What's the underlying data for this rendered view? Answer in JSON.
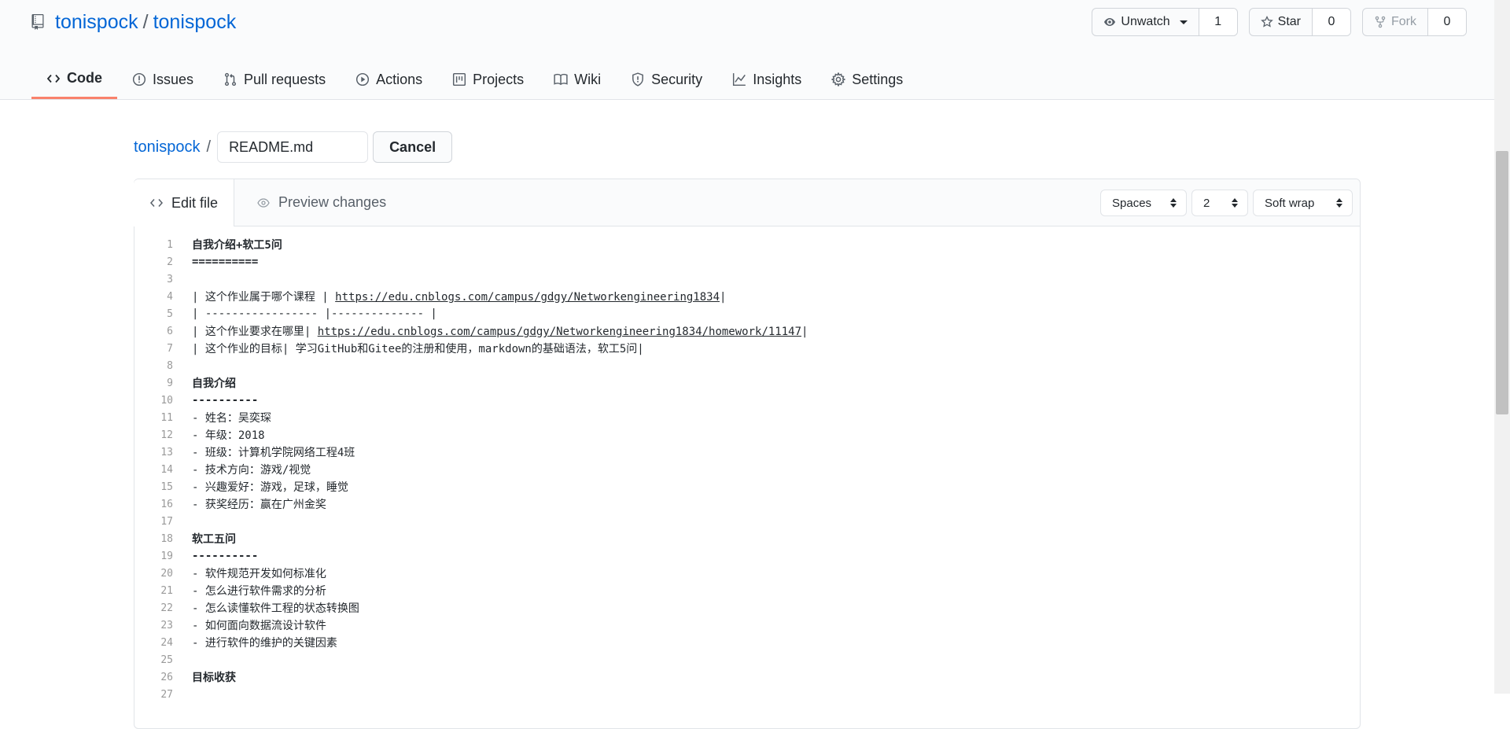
{
  "repo": {
    "owner": "tonispock",
    "name": "tonispock"
  },
  "actions": {
    "unwatch": {
      "label": "Unwatch",
      "count": "1"
    },
    "star": {
      "label": "Star",
      "count": "0"
    },
    "fork": {
      "label": "Fork",
      "count": "0"
    }
  },
  "tabs": [
    {
      "label": "Code",
      "icon": "code-icon"
    },
    {
      "label": "Issues",
      "icon": "issue-icon"
    },
    {
      "label": "Pull requests",
      "icon": "pull-request-icon"
    },
    {
      "label": "Actions",
      "icon": "play-icon"
    },
    {
      "label": "Projects",
      "icon": "project-icon"
    },
    {
      "label": "Wiki",
      "icon": "book-icon"
    },
    {
      "label": "Security",
      "icon": "shield-icon"
    },
    {
      "label": "Insights",
      "icon": "graph-icon"
    },
    {
      "label": "Settings",
      "icon": "gear-icon"
    }
  ],
  "breadcrumb": {
    "owner": "tonispock",
    "separator": "/",
    "filename": "README.md",
    "cancel": "Cancel"
  },
  "editor": {
    "edit_tab": "Edit file",
    "preview_tab": "Preview changes",
    "indent_mode": "Spaces",
    "indent_size": "2",
    "wrap_mode": "Soft wrap",
    "lines": [
      {
        "n": "1",
        "text": "自我介绍+软工5问",
        "bold": true
      },
      {
        "n": "2",
        "text": "==========",
        "bold": true
      },
      {
        "n": "3",
        "text": ""
      },
      {
        "n": "4",
        "pre": "| 这个作业属于哪个课程 | ",
        "link": "https://edu.cnblogs.com/campus/gdgy/Networkengineering1834",
        "post": "|"
      },
      {
        "n": "5",
        "text": "| ----------------- |-------------- |"
      },
      {
        "n": "6",
        "pre": "| 这个作业要求在哪里| ",
        "link": "https://edu.cnblogs.com/campus/gdgy/Networkengineering1834/homework/11147",
        "post": "|"
      },
      {
        "n": "7",
        "text": "| 这个作业的目标| 学习GitHub和Gitee的注册和使用，markdown的基础语法，软工5问|"
      },
      {
        "n": "8",
        "text": ""
      },
      {
        "n": "9",
        "text": "自我介绍",
        "bold": true
      },
      {
        "n": "10",
        "text": "----------",
        "bold": true
      },
      {
        "n": "11",
        "text": "- 姓名：吴奕琛"
      },
      {
        "n": "12",
        "text": "- 年级：2018"
      },
      {
        "n": "13",
        "text": "- 班级：计算机学院网络工程4班"
      },
      {
        "n": "14",
        "text": "- 技术方向：游戏/视觉"
      },
      {
        "n": "15",
        "text": "- 兴趣爱好：游戏，足球，睡觉"
      },
      {
        "n": "16",
        "text": "- 获奖经历：赢在广州金奖"
      },
      {
        "n": "17",
        "text": ""
      },
      {
        "n": "18",
        "text": "软工五问",
        "bold": true
      },
      {
        "n": "19",
        "text": "----------",
        "bold": true
      },
      {
        "n": "20",
        "text": "- 软件规范开发如何标准化"
      },
      {
        "n": "21",
        "text": "- 怎么进行软件需求的分析"
      },
      {
        "n": "22",
        "text": "- 怎么读懂软件工程的状态转换图"
      },
      {
        "n": "23",
        "text": "- 如何面向数据流设计软件"
      },
      {
        "n": "24",
        "text": "- 进行软件的维护的关键因素"
      },
      {
        "n": "25",
        "text": ""
      },
      {
        "n": "26",
        "text": "目标收获",
        "bold": true
      },
      {
        "n": "27",
        "text": ""
      }
    ]
  },
  "colors": {
    "link": "#0366d6",
    "active_tab_underline": "#f9826c"
  }
}
